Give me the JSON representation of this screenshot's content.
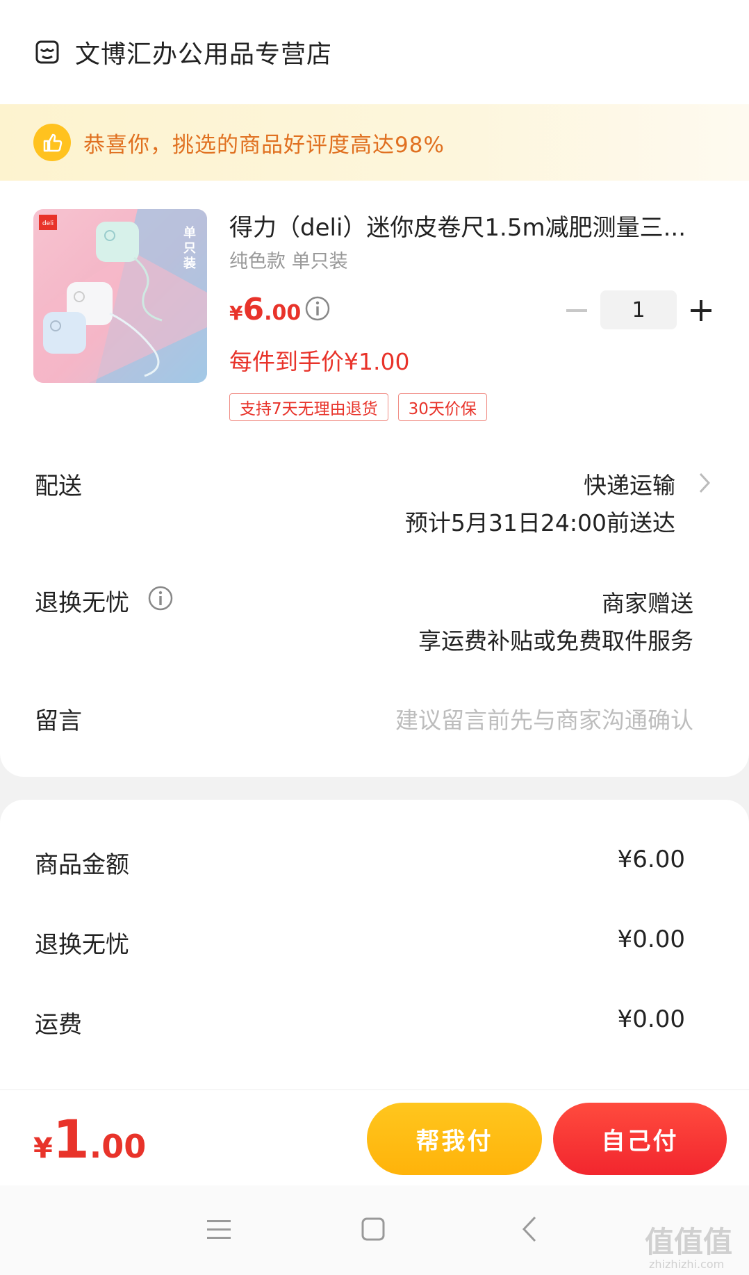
{
  "shop": {
    "name": "文博汇办公用品专营店",
    "icon": "store-icon"
  },
  "banner": {
    "text": "恭喜你，挑选的商品好评度高达98%",
    "icon": "thumbs-up-icon"
  },
  "product": {
    "title": "得力（deli）迷你皮卷尺1.5m减肥测量三...",
    "spec": "纯色款 单只装",
    "price_symbol": "¥",
    "price_int": "6",
    "price_dec": ".00",
    "quantity": "1",
    "final_price": "每件到手价¥1.00",
    "tags": [
      "支持7天无理由退货",
      "30天价保"
    ],
    "image_brand": "deli",
    "image_badge": "单只装"
  },
  "delivery": {
    "label": "配送",
    "method": "快递运输",
    "eta": "预计5月31日24:00前送达"
  },
  "returns": {
    "label": "退换无忧",
    "line1": "商家赠送",
    "line2": "享运费补贴或免费取件服务"
  },
  "message": {
    "label": "留言",
    "placeholder": "建议留言前先与商家沟通确认"
  },
  "summary": [
    {
      "label": "商品金额",
      "value": "¥6.00"
    },
    {
      "label": "退换无忧",
      "value": "¥0.00"
    },
    {
      "label": "运费",
      "value": "¥0.00"
    }
  ],
  "footer": {
    "total_symbol": "¥",
    "total_int": "1",
    "total_dec": ".00",
    "help_pay": "帮我付",
    "self_pay": "自己付"
  },
  "watermark": {
    "text": "值值值",
    "site": "zhizhizhi.com"
  },
  "colors": {
    "accent": "#e8332a",
    "banner_text": "#e07020",
    "help_button": "#ffb30a",
    "self_button": "#f2262e"
  }
}
